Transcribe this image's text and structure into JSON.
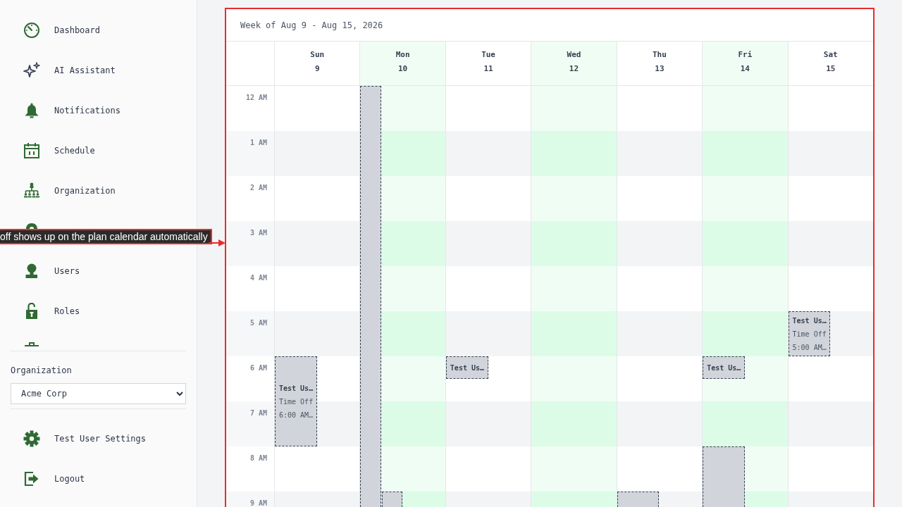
{
  "sidebar": {
    "nav": [
      {
        "label": "Dashboard"
      },
      {
        "label": "AI Assistant"
      },
      {
        "label": "Notifications"
      },
      {
        "label": "Schedule"
      },
      {
        "label": "Organization"
      },
      {
        "label": "Users"
      },
      {
        "label": "Roles"
      }
    ],
    "organization": {
      "label": "Organization",
      "value": "Acme Corp"
    },
    "footer": [
      {
        "label": "Test User Settings"
      },
      {
        "label": "Logout"
      }
    ]
  },
  "calendar": {
    "title": "Week of Aug 9 - Aug 15, 2026",
    "days": [
      {
        "name": "Sun",
        "date": "9",
        "highlighted": false,
        "events": [
          {
            "title": "Test Us…",
            "type": "Time Off",
            "time": "6:00 AM…"
          }
        ]
      },
      {
        "name": "Mon",
        "date": "10",
        "highlighted": true
      },
      {
        "name": "Tue",
        "date": "11",
        "highlighted": false,
        "events": [
          {
            "title": "Test Us…"
          }
        ]
      },
      {
        "name": "Wed",
        "date": "12",
        "highlighted": true
      },
      {
        "name": "Thu",
        "date": "13",
        "highlighted": false
      },
      {
        "name": "Fri",
        "date": "14",
        "highlighted": true,
        "events": [
          {
            "title": "Test Us…"
          }
        ]
      },
      {
        "name": "Sat",
        "date": "15",
        "highlighted": false,
        "events": [
          {
            "title": "Test Us…",
            "type": "Time Off",
            "time": "5:00 AM…"
          }
        ]
      }
    ],
    "hours": [
      "12 AM",
      "1 AM",
      "2 AM",
      "3 AM",
      "4 AM",
      "5 AM",
      "6 AM",
      "7 AM",
      "8 AM",
      "9 AM"
    ]
  },
  "annotation": {
    "text": "off shows up on the plan calendar automatically",
    "highlight_calendar": true
  }
}
